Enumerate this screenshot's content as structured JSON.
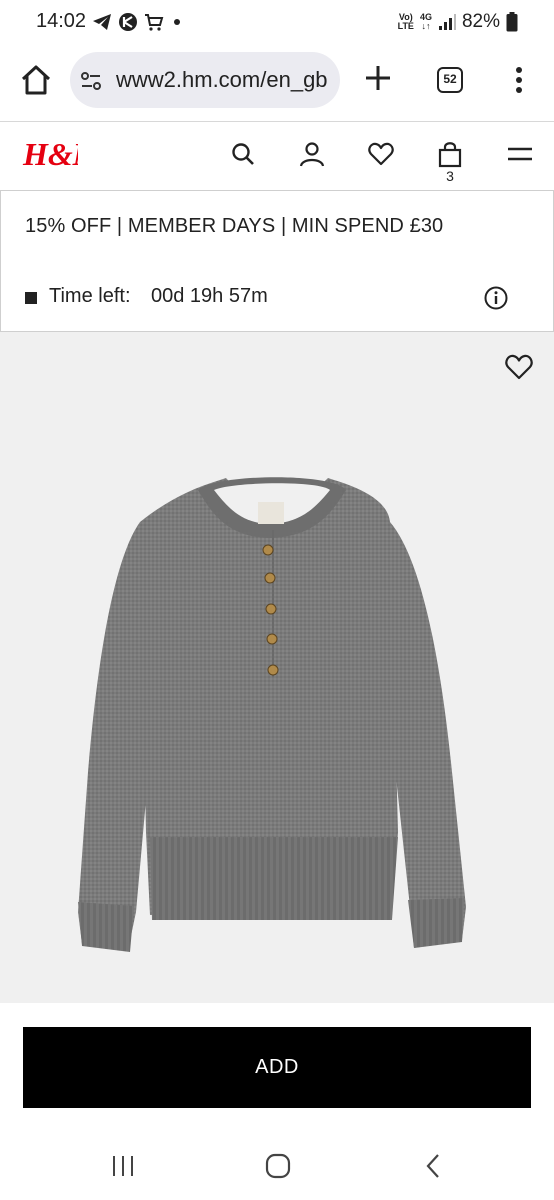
{
  "status_bar": {
    "time": "14:02",
    "left_icons": [
      "telegram-icon",
      "vpn-icon",
      "cart-notification-icon",
      "dot-icon"
    ],
    "network_top": "Vo)",
    "network_bottom": "LTE",
    "network_type": "4G",
    "battery": "82%"
  },
  "browser": {
    "url": "www2.hm.com/en_gb",
    "tab_count": "52"
  },
  "header": {
    "logo": "H&M",
    "brand_color": "#e50010",
    "cart_count": "3"
  },
  "promo": {
    "title": "15% OFF | MEMBER DAYS | MIN SPEND £30",
    "time_left_label": "Time left:",
    "time_left_value": "00d 19h 57m"
  },
  "product": {
    "colors": {
      "background": "#f0f0f0",
      "sweater": "#7b7b7b",
      "buttons": "#b08a4a"
    }
  },
  "actions": {
    "add_label": "ADD"
  }
}
